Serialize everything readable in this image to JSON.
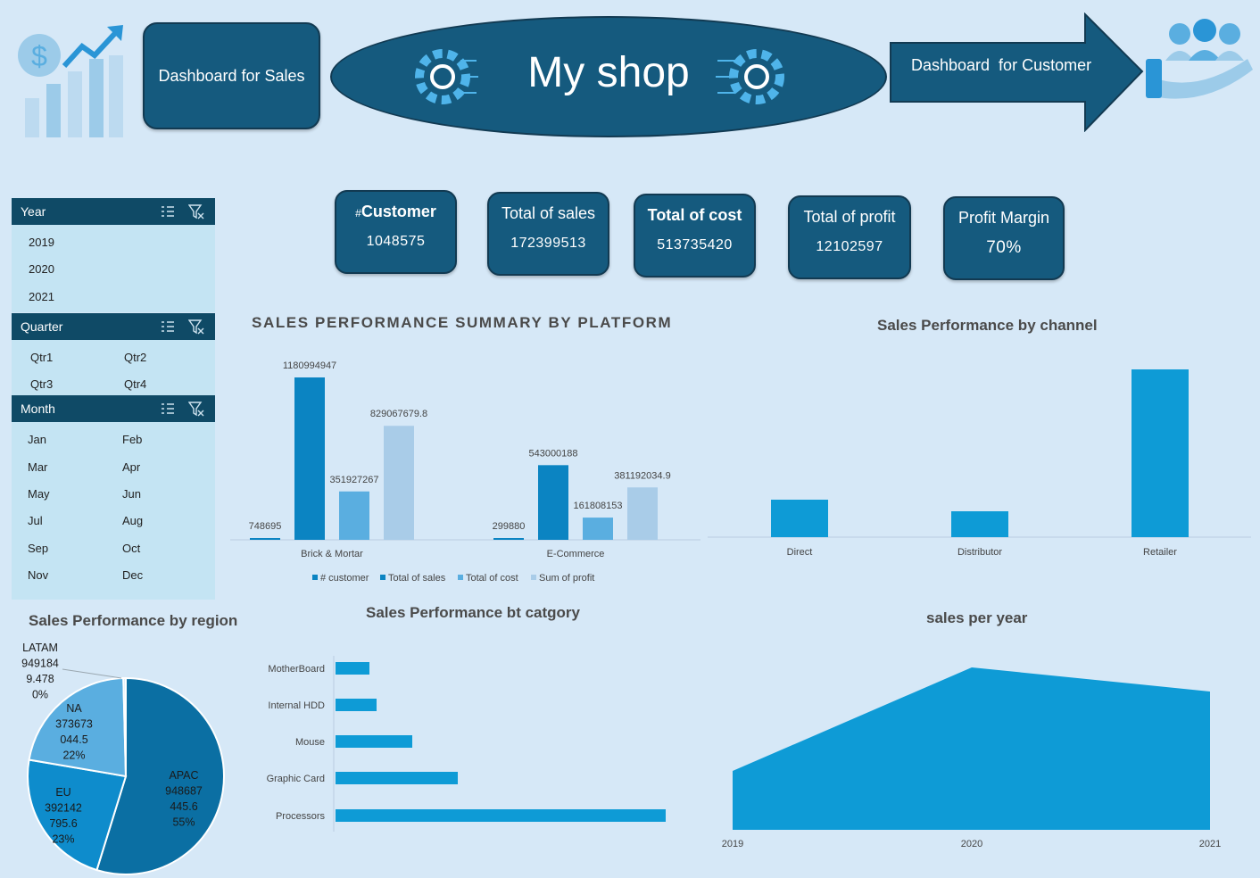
{
  "header": {
    "sales_button": "Dashboard for Sales",
    "shop_title": "My shop",
    "customer_button": "Dashboard  for Customer"
  },
  "kpis": [
    {
      "prefix": "#",
      "label": "Customer",
      "value": "1048575"
    },
    {
      "prefix": "",
      "label": "Total of sales",
      "value": "172399513"
    },
    {
      "prefix": "",
      "label": "Total of cost",
      "value": "513735420"
    },
    {
      "prefix": "",
      "label": "Total of profit",
      "value": "12102597"
    },
    {
      "prefix": "",
      "label": "Profit Margin",
      "value": "70%"
    }
  ],
  "slicers": {
    "year": {
      "title": "Year",
      "items": [
        "2019",
        "2020",
        "2021"
      ]
    },
    "quarter": {
      "title": "Quarter",
      "items": [
        "Qtr1",
        "Qtr2",
        "Qtr3",
        "Qtr4"
      ]
    },
    "month": {
      "title": "Month",
      "items": [
        "Jan",
        "Feb",
        "Mar",
        "Apr",
        "May",
        "Jun",
        "Jul",
        "Aug",
        "Sep",
        "Oct",
        "Nov",
        "Dec"
      ]
    }
  },
  "colors": {
    "background": "#d6e8f7",
    "dark_blue": "#155a7e",
    "bar_blue": "#0e9bd6",
    "bar_mid": "#0b84c2",
    "bar_light": "#5aaee0",
    "bar_pale": "#a9cce8"
  },
  "chart_data": [
    {
      "type": "bar",
      "title": "SALES PERFORMANCE SUMMARY BY PLATFORM",
      "categories": [
        "Brick & Mortar",
        "E-Commerce"
      ],
      "series": [
        {
          "name": "# customer",
          "values": [
            748695,
            299880
          ],
          "labels": [
            "748695",
            "299880"
          ]
        },
        {
          "name": "Total of sales",
          "values": [
            1180994947,
            543000188
          ],
          "labels": [
            "1180994947",
            "543000188"
          ]
        },
        {
          "name": "Total of cost",
          "values": [
            351927267,
            161808153
          ],
          "labels": [
            "351927267",
            "161808153"
          ]
        },
        {
          "name": "Sum of profit",
          "values": [
            829067679.8,
            381192034.9
          ],
          "labels": [
            "829067679.8",
            "381192034.9"
          ]
        }
      ],
      "ylim": [
        0,
        1180994947
      ],
      "legend": "bottom"
    },
    {
      "type": "bar",
      "title": "Sales Performance by channel",
      "categories": [
        "Direct",
        "Distributor",
        "Retailer"
      ],
      "values": [
        42,
        29,
        188
      ]
    },
    {
      "type": "pie",
      "title": "Sales Performance by region",
      "slices": [
        {
          "name": "APAC",
          "value": 55,
          "lines": [
            "APAC",
            "948687",
            "445.6",
            "55%"
          ]
        },
        {
          "name": "EU",
          "value": 23,
          "lines": [
            "EU",
            "392142",
            "795.6",
            "23%"
          ]
        },
        {
          "name": "NA",
          "value": 22,
          "lines": [
            "NA",
            "373673",
            "044.5",
            "22%"
          ]
        },
        {
          "name": "LATAM",
          "value": 0.4,
          "lines": [
            "LATAM",
            "949184",
            "9.478",
            "0%"
          ]
        }
      ]
    },
    {
      "type": "bar",
      "orientation": "horizontal",
      "title": "Sales Performance bt catgory",
      "categories": [
        "MotherBoard",
        "Internal HDD",
        "Mouse",
        "Graphic Card",
        "Processors"
      ],
      "values": [
        38,
        46,
        86,
        137,
        370
      ]
    },
    {
      "type": "area",
      "title": "sales per year",
      "x": [
        "2019",
        "2020",
        "2021"
      ],
      "values": [
        66,
        182,
        155
      ]
    }
  ]
}
